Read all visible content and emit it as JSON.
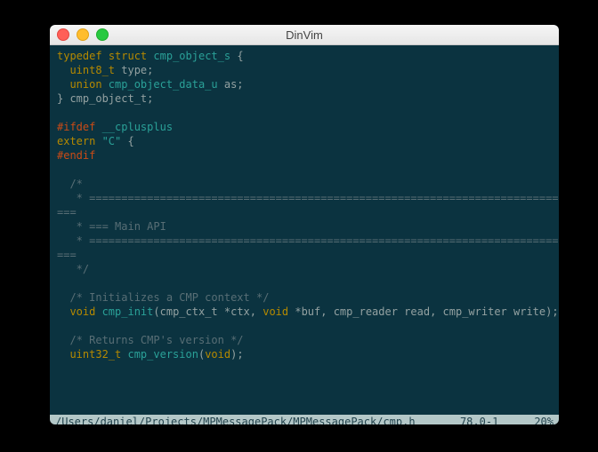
{
  "window": {
    "title": "DinVim"
  },
  "code": {
    "line1": {
      "typedef": "typedef",
      "struct": "struct",
      "name": "cmp_object_s",
      "open": " {",
      "indent": ""
    },
    "line2": {
      "indent": "  ",
      "type": "uint8_t",
      "rest": " type;"
    },
    "line3": {
      "indent": "  ",
      "kw": "union",
      "name": " cmp_object_data_u",
      "rest": " as;"
    },
    "line4": {
      "text": "} cmp_object_t;"
    },
    "blank1": " ",
    "line5": {
      "pre": "#ifdef",
      "rest": " __cplusplus"
    },
    "line6": {
      "kw": "extern",
      "str": " \"C\"",
      "rest": " {"
    },
    "line7": {
      "pre": "#endif"
    },
    "blank2": " ",
    "cmt1": "  /*",
    "cmt2": "   * ====================================================================================================",
    "cmt3": "   * === Main API",
    "cmt4": "   * ====================================================================================================",
    "cmt4b": "===",
    "cmt5": "   */",
    "blank3": " ",
    "cmt6": "  /* Initializes a CMP context */",
    "line8": {
      "indent": "  ",
      "ret": "void",
      "name": " cmp_init",
      "open": "(",
      "p1t": "cmp_ctx_t ",
      "p1n": "*ctx, ",
      "p2t": "void ",
      "p2n": "*buf, cmp_reader read, cmp_writer write",
      "close": ");"
    },
    "blank4": " ",
    "cmt7": "  /* Returns CMP's version */",
    "line9": {
      "indent": "  ",
      "ret": "uint32_t",
      "name": " cmp_version",
      "open": "(",
      "arg": "void",
      "close": ");"
    }
  },
  "status": {
    "file": "/Users/daniel/Projects/MPMessagePack/MPMessagePack/cmp.h",
    "pos": "78,0-1",
    "pct": "20%"
  }
}
